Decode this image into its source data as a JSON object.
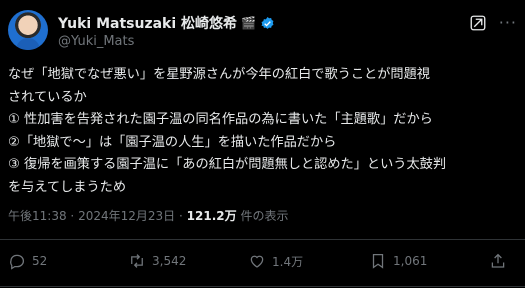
{
  "author": {
    "name": "Yuki Matsuzaki 松崎悠希",
    "emoji": "🎬",
    "handle": "@Yuki_Mats"
  },
  "post": {
    "text": "なぜ「地獄でなぜ悪い」を星野源さんが今年の紅白で歌うことが問題視\nされているか\n① 性加害を告発された園子温の同名作品の為に書いた「主題歌」だから\n②「地獄で〜」は「園子温の人生」を描いた作品だから\n③ 復帰を画策する園子温に「あの紅白が問題無しと認めた」という太鼓判\nを与えてしまうため"
  },
  "meta": {
    "time": "午後11:38",
    "date": "2024年12月23日",
    "views": "121.2万",
    "views_label": "件の表示",
    "sep": "·"
  },
  "actions": {
    "replies": "52",
    "reposts": "3,542",
    "likes": "1.4万",
    "bookmarks": "1,061"
  },
  "colors": {
    "background": "#000000",
    "text": "#e7e9ea",
    "secondary": "#71767b",
    "verified": "#1d9bf0",
    "divider": "#2f3336"
  }
}
